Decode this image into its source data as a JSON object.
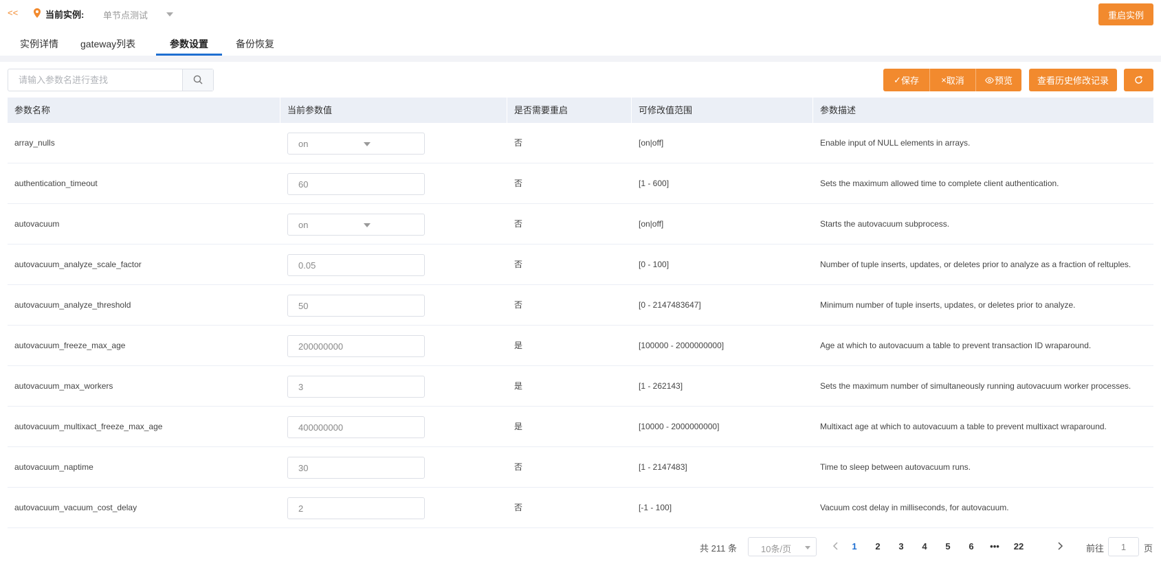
{
  "header": {
    "back_label": "<<",
    "instance_label": "当前实例:",
    "instance_value": "单节点测试",
    "restart_label": "重启实例"
  },
  "tabs": [
    {
      "label": "实例详情"
    },
    {
      "label": "gateway列表"
    },
    {
      "label": "参数设置",
      "active": true
    },
    {
      "label": "备份恢复"
    }
  ],
  "toolbar": {
    "search_placeholder": "请输入参数名进行查找",
    "save_label": "保存",
    "cancel_label": "取消",
    "preview_label": "预览",
    "history_label": "查看历史修改记录"
  },
  "table": {
    "columns": [
      "参数名称",
      "当前参数值",
      "是否需要重启",
      "可修改值范围",
      "参数描述"
    ],
    "rows": [
      {
        "name": "array_nulls",
        "value": "on",
        "is_select": true,
        "restart": "否",
        "range": "[on|off]",
        "desc": "Enable input of NULL elements in arrays."
      },
      {
        "name": "authentication_timeout",
        "value": "60",
        "is_select": false,
        "restart": "否",
        "range": "[1 - 600]",
        "desc": "Sets the maximum allowed time to complete client authentication."
      },
      {
        "name": "autovacuum",
        "value": "on",
        "is_select": true,
        "restart": "否",
        "range": "[on|off]",
        "desc": "Starts the autovacuum subprocess."
      },
      {
        "name": "autovacuum_analyze_scale_factor",
        "value": "0.05",
        "is_select": false,
        "restart": "否",
        "range": "[0 - 100]",
        "desc": "Number of tuple inserts, updates, or deletes prior to analyze as a fraction of reltuples."
      },
      {
        "name": "autovacuum_analyze_threshold",
        "value": "50",
        "is_select": false,
        "restart": "否",
        "range": "[0 - 2147483647]",
        "desc": "Minimum number of tuple inserts, updates, or deletes prior to analyze."
      },
      {
        "name": "autovacuum_freeze_max_age",
        "value": "200000000",
        "is_select": false,
        "restart": "是",
        "range": "[100000 - 2000000000]",
        "desc": "Age at which to autovacuum a table to prevent transaction ID wraparound."
      },
      {
        "name": "autovacuum_max_workers",
        "value": "3",
        "is_select": false,
        "restart": "是",
        "range": "[1 - 262143]",
        "desc": "Sets the maximum number of simultaneously running autovacuum worker processes."
      },
      {
        "name": "autovacuum_multixact_freeze_max_age",
        "value": "400000000",
        "is_select": false,
        "restart": "是",
        "range": "[10000 - 2000000000]",
        "desc": "Multixact age at which to autovacuum a table to prevent multixact wraparound."
      },
      {
        "name": "autovacuum_naptime",
        "value": "30",
        "is_select": false,
        "restart": "否",
        "range": "[1 - 2147483]",
        "desc": "Time to sleep between autovacuum runs."
      },
      {
        "name": "autovacuum_vacuum_cost_delay",
        "value": "2",
        "is_select": false,
        "restart": "否",
        "range": "[-1 - 100]",
        "desc": "Vacuum cost delay in milliseconds, for autovacuum."
      }
    ]
  },
  "pagination": {
    "total_label": "共 211 条",
    "page_size": "10条/页",
    "pages": [
      "1",
      "2",
      "3",
      "4",
      "5",
      "6",
      "•••",
      "22"
    ],
    "current_page": "1",
    "goto_label": "前往",
    "goto_value": "1",
    "goto_suffix": "页"
  },
  "colors": {
    "accent": "#f28a2e",
    "active_tab": "#1f6fd1",
    "header_bg": "#ebeff6"
  }
}
